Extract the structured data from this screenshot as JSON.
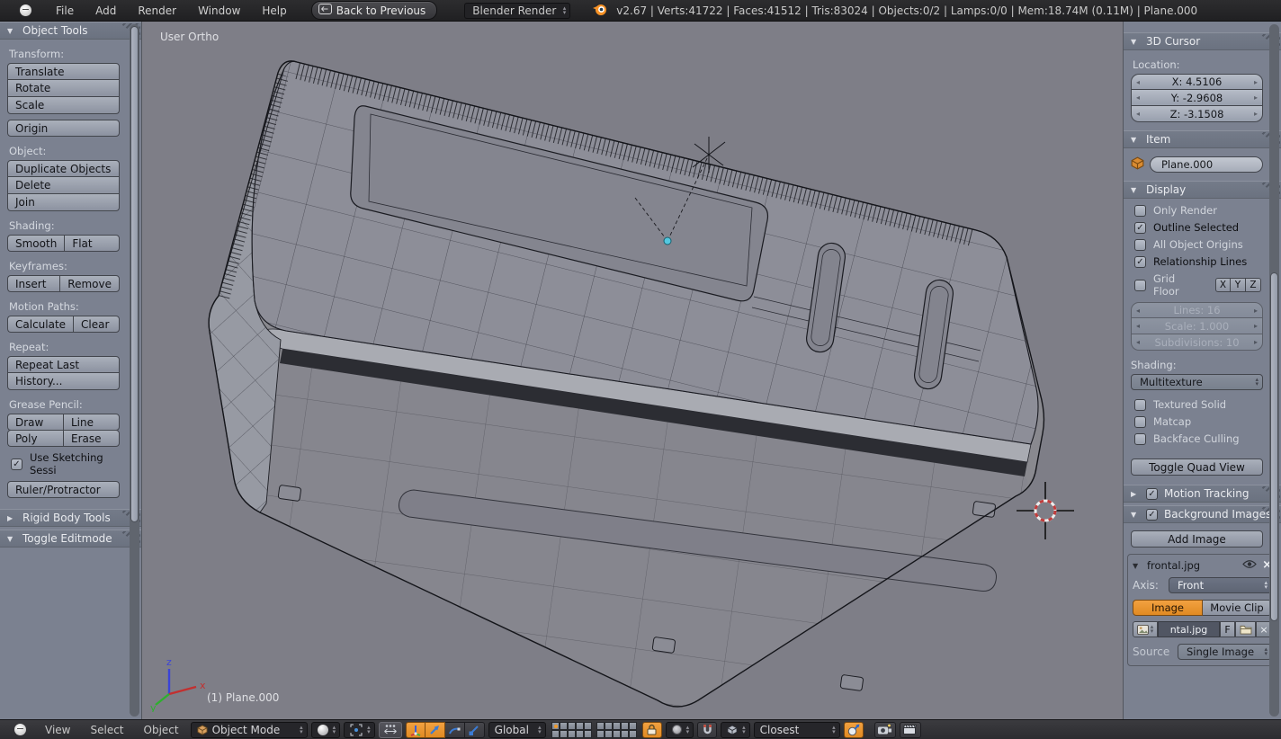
{
  "topbar": {
    "menu_file": "File",
    "menu_add": "Add",
    "menu_render": "Render",
    "menu_window": "Window",
    "menu_help": "Help",
    "back_button": "Back to Previous",
    "engine": "Blender Render",
    "stats": "v2.67 | Verts:41722 | Faces:41512 | Tris:83024 | Objects:0/2 | Lamps:0/0 | Mem:18.74M (0.11M) | Plane.000"
  },
  "tool_shelf": {
    "header": "Object Tools",
    "transform_label": "Transform:",
    "translate": "Translate",
    "rotate": "Rotate",
    "scale": "Scale",
    "origin": "Origin",
    "object_label": "Object:",
    "duplicate": "Duplicate Objects",
    "delete": "Delete",
    "join": "Join",
    "shading_label": "Shading:",
    "smooth": "Smooth",
    "flat": "Flat",
    "keyframes_label": "Keyframes:",
    "insert": "Insert",
    "remove": "Remove",
    "motion_paths_label": "Motion Paths:",
    "calculate": "Calculate",
    "clear": "Clear",
    "repeat_label": "Repeat:",
    "repeat_last": "Repeat Last",
    "history": "History...",
    "grease_label": "Grease Pencil:",
    "draw": "Draw",
    "line": "Line",
    "poly": "Poly",
    "erase": "Erase",
    "use_sketching": "Use Sketching Sessi",
    "ruler": "Ruler/Protractor",
    "rigid_body": "Rigid Body Tools",
    "toggle_editmode": "Toggle Editmode"
  },
  "viewport": {
    "view_label": "User Ortho",
    "object_info": "(1) Plane.000",
    "axis_x": "x",
    "axis_y": "y",
    "axis_z": "z"
  },
  "npanel": {
    "cursor_header": "3D Cursor",
    "location_label": "Location:",
    "loc_x": "X: 4.5106",
    "loc_y": "Y: -2.9608",
    "loc_z": "Z: -3.1508",
    "item_header": "Item",
    "item_name": "Plane.000",
    "display_header": "Display",
    "only_render": "Only Render",
    "outline_selected": "Outline Selected",
    "all_object_origins": "All Object Origins",
    "relationship_lines": "Relationship Lines",
    "grid_floor": "Grid Floor",
    "gx": "X",
    "gy": "Y",
    "gz": "Z",
    "lines": "Lines: 16",
    "scale": "Scale: 1.000",
    "subdivisions": "Subdivisions: 10",
    "shading_label": "Shading:",
    "shading_mode": "Multitexture",
    "textured_solid": "Textured Solid",
    "matcap": "Matcap",
    "backface_culling": "Backface Culling",
    "toggle_quad": "Toggle Quad View",
    "motion_tracking": "Motion Tracking",
    "background_images": "Background Images",
    "add_image": "Add Image",
    "bg_image_name": "frontal.jpg",
    "axis_label": "Axis:",
    "axis_value": "Front",
    "tab_image": "Image",
    "tab_movie_clip": "Movie Clip",
    "datablock_name": "ntal.jpg",
    "fake_user": "F",
    "source_label": "Source",
    "source_value": "Single Image"
  },
  "bottombar": {
    "menu_view": "View",
    "menu_select": "Select",
    "menu_object": "Object",
    "mode": "Object Mode",
    "orientation": "Global",
    "snap_mode": "Closest"
  },
  "colors": {
    "accent_orange": "#ea9532",
    "origin_dot": "#54c8e0",
    "cursor_red": "#c03c3c",
    "axis_x_red": "#c23030",
    "axis_y_green": "#2faf2f",
    "axis_z_blue": "#3b44d8",
    "panel_gray": "#7b8190",
    "viewport_gray": "#7e7e87",
    "header_dark": "#26262a"
  }
}
